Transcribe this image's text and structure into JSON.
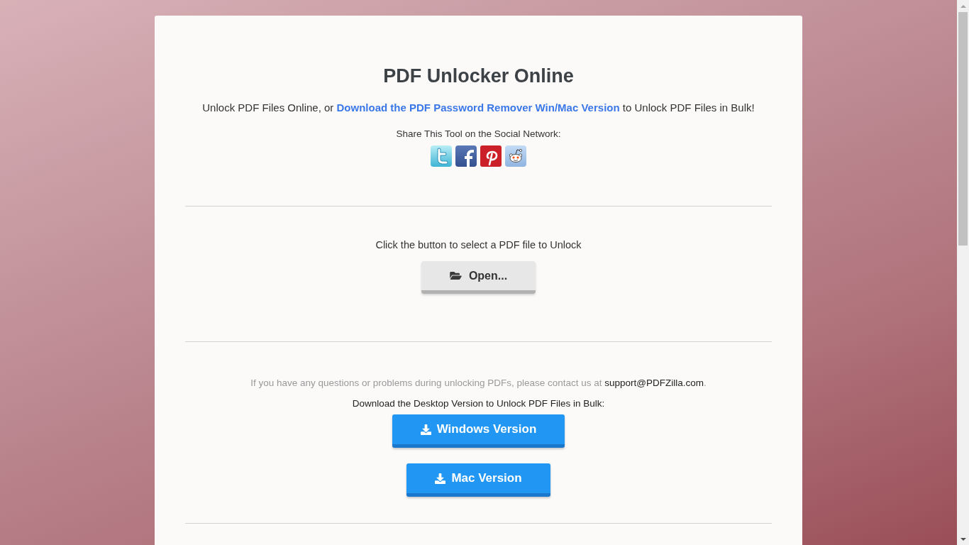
{
  "title": "PDF Unlocker Online",
  "intro": {
    "text_before": "Unlock PDF Files Online, or ",
    "link": "Download the PDF Password Remover Win/Mac Version",
    "text_after": " to Unlock PDF Files in Bulk!"
  },
  "share": {
    "label": "Share This Tool on the Social Network:"
  },
  "upload": {
    "instruction": "Click the button to select a PDF file to Unlock",
    "button": "Open..."
  },
  "contact": {
    "text_before": "If you have any questions or problems during unlocking PDFs, please contact us at ",
    "email": "support@PDFZilla.com",
    "text_after": "."
  },
  "downloads": {
    "label": "Download the Desktop Version to Unlock PDF Files in Bulk:",
    "buttons": [
      {
        "label": "Windows Version"
      },
      {
        "label": "Mac Version"
      }
    ]
  }
}
